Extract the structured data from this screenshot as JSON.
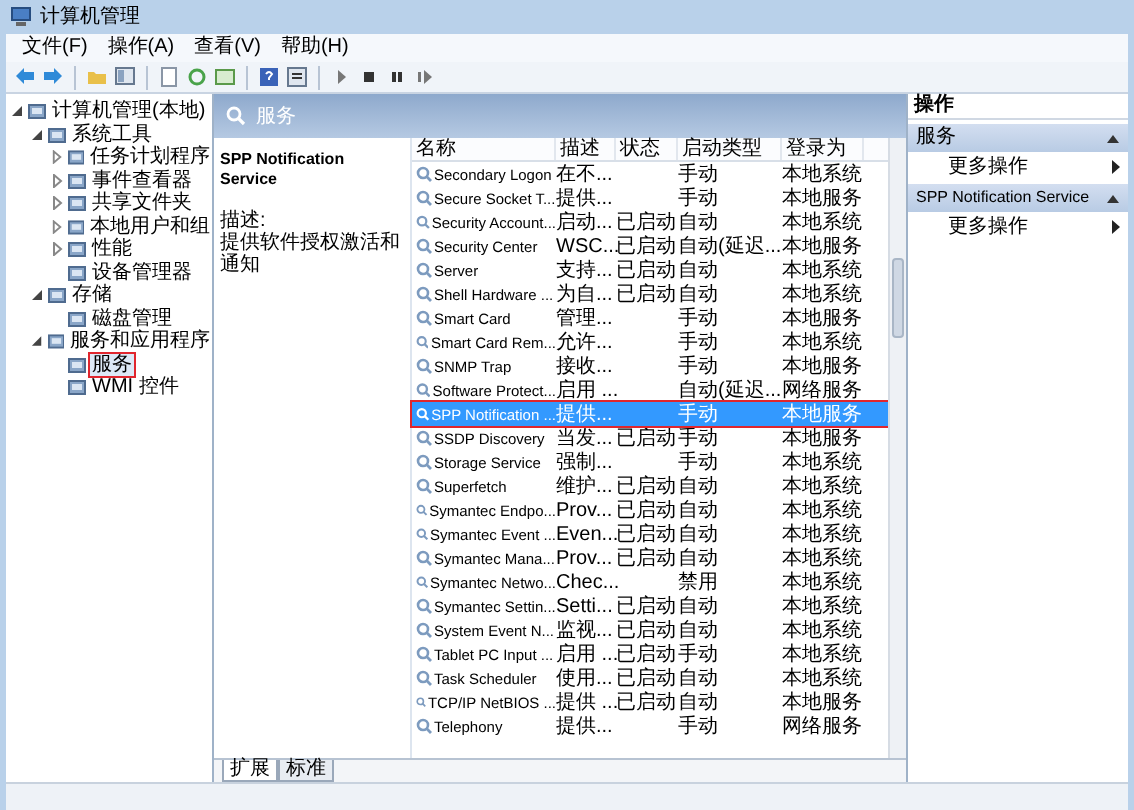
{
  "window": {
    "title": "计算机管理"
  },
  "menu": [
    "文件(F)",
    "操作(A)",
    "查看(V)",
    "帮助(H)"
  ],
  "tree": [
    {
      "label": "计算机管理(本地)",
      "expanded": true,
      "selected": false,
      "highlighted": false,
      "children": [
        {
          "label": "系统工具",
          "expanded": true,
          "selected": false,
          "highlighted": false,
          "children": [
            {
              "label": "任务计划程序",
              "expanded": false,
              "selected": false,
              "highlighted": false
            },
            {
              "label": "事件查看器",
              "expanded": false,
              "selected": false,
              "highlighted": false
            },
            {
              "label": "共享文件夹",
              "expanded": false,
              "selected": false,
              "highlighted": false
            },
            {
              "label": "本地用户和组",
              "expanded": false,
              "selected": false,
              "highlighted": false
            },
            {
              "label": "性能",
              "expanded": false,
              "selected": false,
              "highlighted": false
            },
            {
              "label": "设备管理器",
              "selected": false,
              "highlighted": false
            }
          ]
        },
        {
          "label": "存储",
          "expanded": true,
          "selected": false,
          "highlighted": false,
          "children": [
            {
              "label": "磁盘管理",
              "selected": false,
              "highlighted": false
            }
          ]
        },
        {
          "label": "服务和应用程序",
          "expanded": true,
          "selected": false,
          "highlighted": false,
          "children": [
            {
              "label": "服务",
              "selected": true,
              "highlighted": true
            },
            {
              "label": "WMI 控件",
              "selected": false,
              "highlighted": false
            }
          ]
        }
      ]
    }
  ],
  "pane_header": "服务",
  "details": {
    "service_name": "SPP Notification Service",
    "description_label": "描述:",
    "description": "提供软件授权激活和通知"
  },
  "table": {
    "columns": [
      "名称",
      "描述",
      "状态",
      "启动类型",
      "登录为"
    ],
    "rows": [
      {
        "cells": [
          "Secondary Logon",
          "在不...",
          "",
          "手动",
          "本地系统"
        ],
        "selected": false,
        "highlighted": false
      },
      {
        "cells": [
          "Secure Socket T...",
          "提供...",
          "",
          "手动",
          "本地服务"
        ],
        "selected": false,
        "highlighted": false
      },
      {
        "cells": [
          "Security Account...",
          "启动...",
          "已启动",
          "自动",
          "本地系统"
        ],
        "selected": false,
        "highlighted": false
      },
      {
        "cells": [
          "Security Center",
          "WSC...",
          "已启动",
          "自动(延迟...",
          "本地服务"
        ],
        "selected": false,
        "highlighted": false
      },
      {
        "cells": [
          "Server",
          "支持...",
          "已启动",
          "自动",
          "本地系统"
        ],
        "selected": false,
        "highlighted": false
      },
      {
        "cells": [
          "Shell Hardware ...",
          "为自...",
          "已启动",
          "自动",
          "本地系统"
        ],
        "selected": false,
        "highlighted": false
      },
      {
        "cells": [
          "Smart Card",
          "管理...",
          "",
          "手动",
          "本地服务"
        ],
        "selected": false,
        "highlighted": false
      },
      {
        "cells": [
          "Smart Card Rem...",
          "允许...",
          "",
          "手动",
          "本地系统"
        ],
        "selected": false,
        "highlighted": false
      },
      {
        "cells": [
          "SNMP Trap",
          "接收...",
          "",
          "手动",
          "本地服务"
        ],
        "selected": false,
        "highlighted": false
      },
      {
        "cells": [
          "Software Protect...",
          "启用 ...",
          "",
          "自动(延迟...",
          "网络服务"
        ],
        "selected": false,
        "highlighted": false
      },
      {
        "cells": [
          "SPP Notification ...",
          "提供...",
          "",
          "手动",
          "本地服务"
        ],
        "selected": true,
        "highlighted": true
      },
      {
        "cells": [
          "SSDP Discovery",
          "当发...",
          "已启动",
          "手动",
          "本地服务"
        ],
        "selected": false,
        "highlighted": false
      },
      {
        "cells": [
          "Storage Service",
          "强制...",
          "",
          "手动",
          "本地系统"
        ],
        "selected": false,
        "highlighted": false
      },
      {
        "cells": [
          "Superfetch",
          "维护...",
          "已启动",
          "自动",
          "本地系统"
        ],
        "selected": false,
        "highlighted": false
      },
      {
        "cells": [
          "Symantec Endpo...",
          "Prov...",
          "已启动",
          "自动",
          "本地系统"
        ],
        "selected": false,
        "highlighted": false
      },
      {
        "cells": [
          "Symantec Event ...",
          "Even...",
          "已启动",
          "自动",
          "本地系统"
        ],
        "selected": false,
        "highlighted": false
      },
      {
        "cells": [
          "Symantec Mana...",
          "Prov...",
          "已启动",
          "自动",
          "本地系统"
        ],
        "selected": false,
        "highlighted": false
      },
      {
        "cells": [
          "Symantec Netwo...",
          "Chec...",
          "",
          "禁用",
          "本地系统"
        ],
        "selected": false,
        "highlighted": false
      },
      {
        "cells": [
          "Symantec Settin...",
          "Setti...",
          "已启动",
          "自动",
          "本地系统"
        ],
        "selected": false,
        "highlighted": false
      },
      {
        "cells": [
          "System Event N...",
          "监视...",
          "已启动",
          "自动",
          "本地系统"
        ],
        "selected": false,
        "highlighted": false
      },
      {
        "cells": [
          "Tablet PC Input ...",
          "启用 ...",
          "已启动",
          "手动",
          "本地系统"
        ],
        "selected": false,
        "highlighted": false
      },
      {
        "cells": [
          "Task Scheduler",
          "使用...",
          "已启动",
          "自动",
          "本地系统"
        ],
        "selected": false,
        "highlighted": false
      },
      {
        "cells": [
          "TCP/IP NetBIOS ...",
          "提供 ...",
          "已启动",
          "自动",
          "本地服务"
        ],
        "selected": false,
        "highlighted": false
      },
      {
        "cells": [
          "Telephony",
          "提供...",
          "",
          "手动",
          "网络服务"
        ],
        "selected": false,
        "highlighted": false
      }
    ]
  },
  "view_tabs": [
    {
      "label": "扩展",
      "selected": true
    },
    {
      "label": "标准",
      "selected": false
    }
  ],
  "actions": {
    "title": "操作",
    "sections": [
      {
        "title": "服务",
        "expanded": true,
        "items": [
          "更多操作"
        ]
      },
      {
        "title": "SPP Notification Service",
        "expanded": true,
        "items": [
          "更多操作"
        ]
      }
    ]
  }
}
